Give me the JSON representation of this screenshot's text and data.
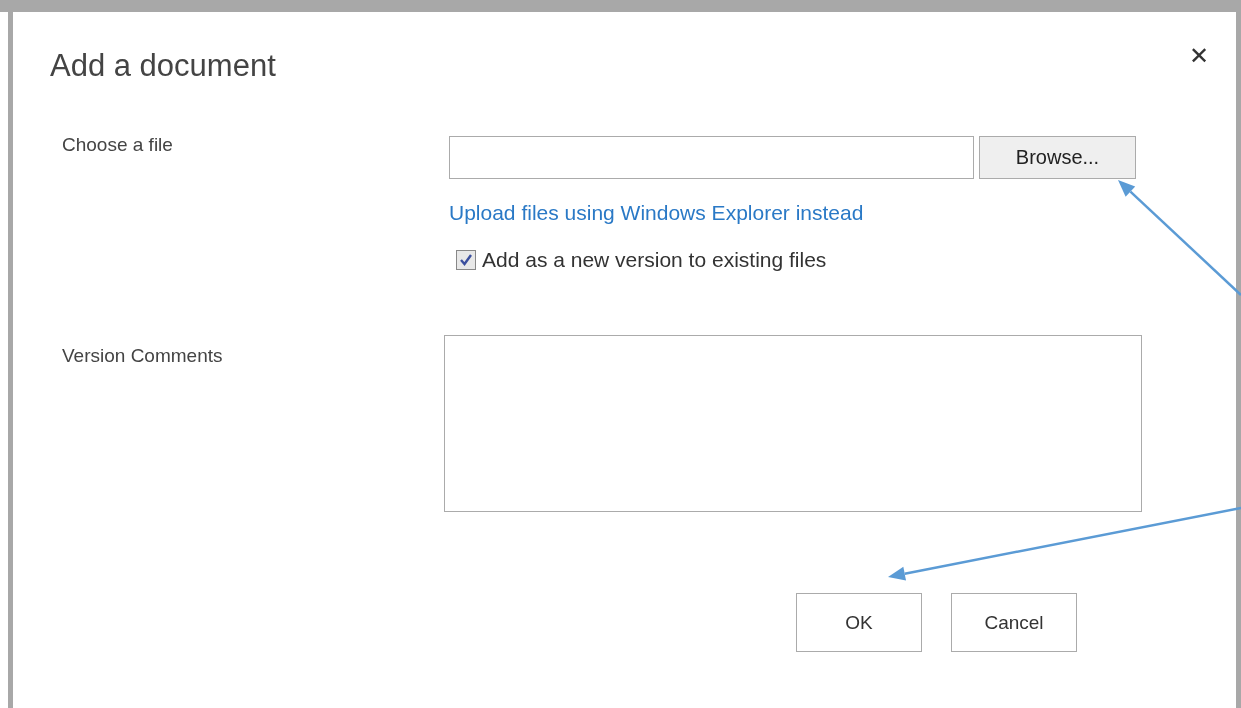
{
  "dialog": {
    "title": "Add a document",
    "close": "✕",
    "file": {
      "label": "Choose a file",
      "browse": "Browse...",
      "link": "Upload files using Windows Explorer instead",
      "option": {
        "label": "Add as a new version to existing files",
        "checked": true
      }
    },
    "comments": {
      "label": "Version Comments"
    },
    "buttons": [
      "OK",
      "Cancel"
    ]
  },
  "annotations": [
    {
      "kind": "arrow"
    },
    {
      "kind": "arrow"
    }
  ]
}
